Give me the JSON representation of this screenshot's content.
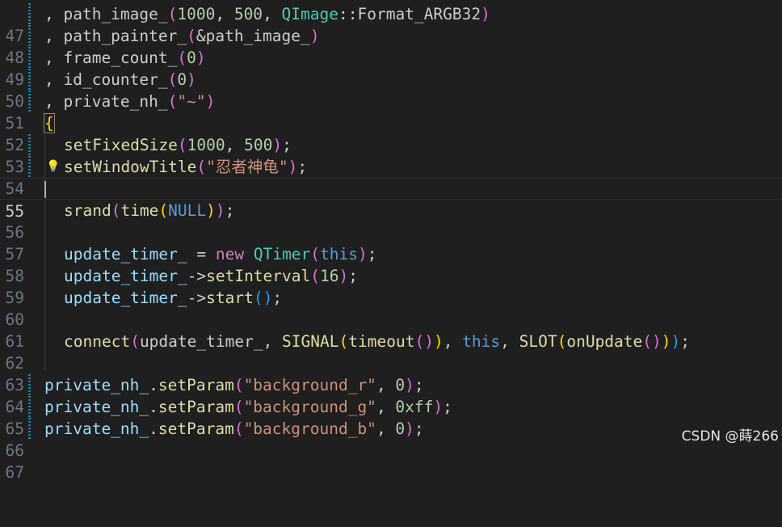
{
  "editor": {
    "lines": [
      {
        "n": "47"
      },
      {
        "n": "48"
      },
      {
        "n": "49"
      },
      {
        "n": "50"
      },
      {
        "n": "51"
      },
      {
        "n": "52"
      },
      {
        "n": "53"
      },
      {
        "n": "54"
      },
      {
        "n": "55"
      },
      {
        "n": "56"
      },
      {
        "n": "57"
      },
      {
        "n": "58"
      },
      {
        "n": "59"
      },
      {
        "n": "60"
      },
      {
        "n": "61"
      },
      {
        "n": "62"
      },
      {
        "n": "63"
      },
      {
        "n": "64"
      },
      {
        "n": "65"
      },
      {
        "n": "66"
      },
      {
        "n": "67"
      }
    ],
    "code": {
      "l47": {
        "a": ", path_image_",
        "b": "(",
        "c": "1000",
        "d": ", ",
        "e": "500",
        "f": ", ",
        "g": "QImage",
        "h": "::Format_ARGB32",
        "i": ")"
      },
      "l48": {
        "a": ", path_painter_",
        "b": "(",
        "c": "&path_image_",
        "d": ")"
      },
      "l49": {
        "a": ", frame_count_",
        "b": "(",
        "c": "0",
        "d": ")"
      },
      "l50": {
        "a": ", id_counter_",
        "b": "(",
        "c": "0",
        "d": ")"
      },
      "l51": {
        "a": ", private_nh_",
        "b": "(",
        "c": "\"~\"",
        "d": ")"
      },
      "l52": {
        "a": "{"
      },
      "l53": {
        "a": "setFixedSize",
        "b": "(",
        "c": "1000",
        "d": ", ",
        "e": "500",
        "f": ")",
        "g": ";"
      },
      "l54": {
        "a": "setWindowTitle",
        "b": "(",
        "c": "\"忍者神龟\"",
        "d": ")",
        "e": ";"
      },
      "l56": {
        "a": "srand",
        "b": "(",
        "c": "time",
        "d": "(",
        "e": "NULL",
        "f": ")",
        "g": ")",
        "h": ";"
      },
      "l58": {
        "a": "update_timer_",
        "b": " = ",
        "c": "new",
        "d": " ",
        "e": "QTimer",
        "f": "(",
        "g": "this",
        "h": ")",
        "i": ";"
      },
      "l59": {
        "a": "update_timer_",
        "b": "->",
        "c": "setInterval",
        "d": "(",
        "e": "16",
        "f": ")",
        "g": ";"
      },
      "l60": {
        "a": "update_timer_",
        "b": "->",
        "c": "start",
        "d": "(",
        "e": ")",
        "f": ";"
      },
      "l62": {
        "a": "connect",
        "b": "(",
        "c": "update_timer_",
        "d": ", ",
        "e": "SIGNAL",
        "f": "(",
        "g": "timeout",
        "h": "(",
        "i": ")",
        "j": ")",
        "k": ", ",
        "l": "this",
        "m": ", ",
        "n": "SLOT",
        "o": "(",
        "p": "onUpdate",
        "q": "(",
        "r": ")",
        "s": ")",
        "t": ")",
        "u": ";"
      },
      "l64": {
        "a": "private_nh_",
        "b": ".",
        "c": "setParam",
        "d": "(",
        "e": "\"background_r\"",
        "f": ", ",
        "g": "0",
        "h": ")",
        "i": ";"
      },
      "l65": {
        "a": "private_nh_",
        "b": ".",
        "c": "setParam",
        "d": "(",
        "e": "\"background_g\"",
        "f": ", ",
        "g": "0xff",
        "h": ")",
        "i": ";"
      },
      "l66": {
        "a": "private_nh_",
        "b": ".",
        "c": "setParam",
        "d": "(",
        "e": "\"background_b\"",
        "f": ", ",
        "g": "0",
        "h": ")",
        "i": ";"
      }
    },
    "lightbulb_icon": "lightbulb-icon",
    "colors": {
      "background": "#1f1f1f",
      "function": "#dcdcaa",
      "variable": "#9cdcfe",
      "number": "#b5cea8",
      "string": "#ce9178",
      "keyword": "#569cd6",
      "type": "#4ec9b0",
      "modified_marker": "#1b81a8"
    }
  },
  "watermark": {
    "text": "CSDN @蒔266"
  }
}
